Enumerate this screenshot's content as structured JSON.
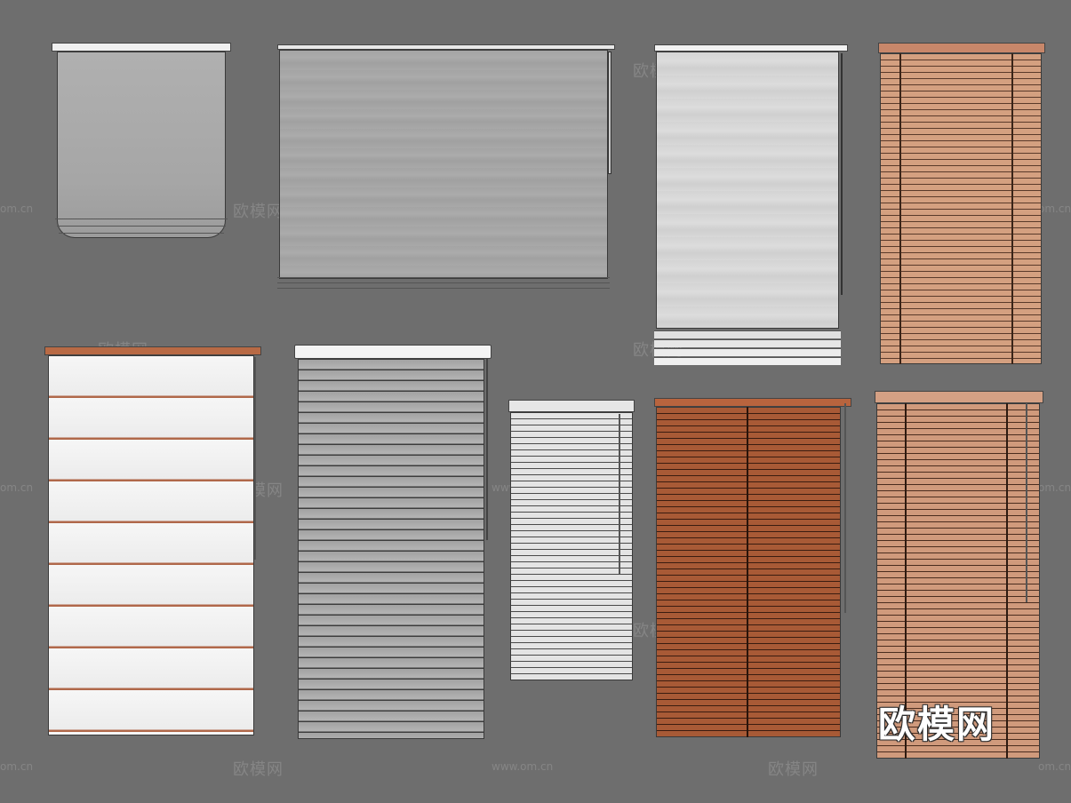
{
  "watermark": {
    "cn": "欧模网",
    "url": "www.om.cn",
    "url_partial": "om.cn"
  },
  "logo": {
    "text": "欧模网"
  },
  "colors": {
    "background": "#6e6e6e",
    "fabric_gray": "#a8a8a8",
    "fabric_light": "#d9d9d9",
    "fabric_white": "#f2f2f2",
    "wood_light": "#d09a7c",
    "wood_dark": "#9a5232",
    "rail_white": "#f0f0f0",
    "rail_wood": "#b8643e"
  }
}
